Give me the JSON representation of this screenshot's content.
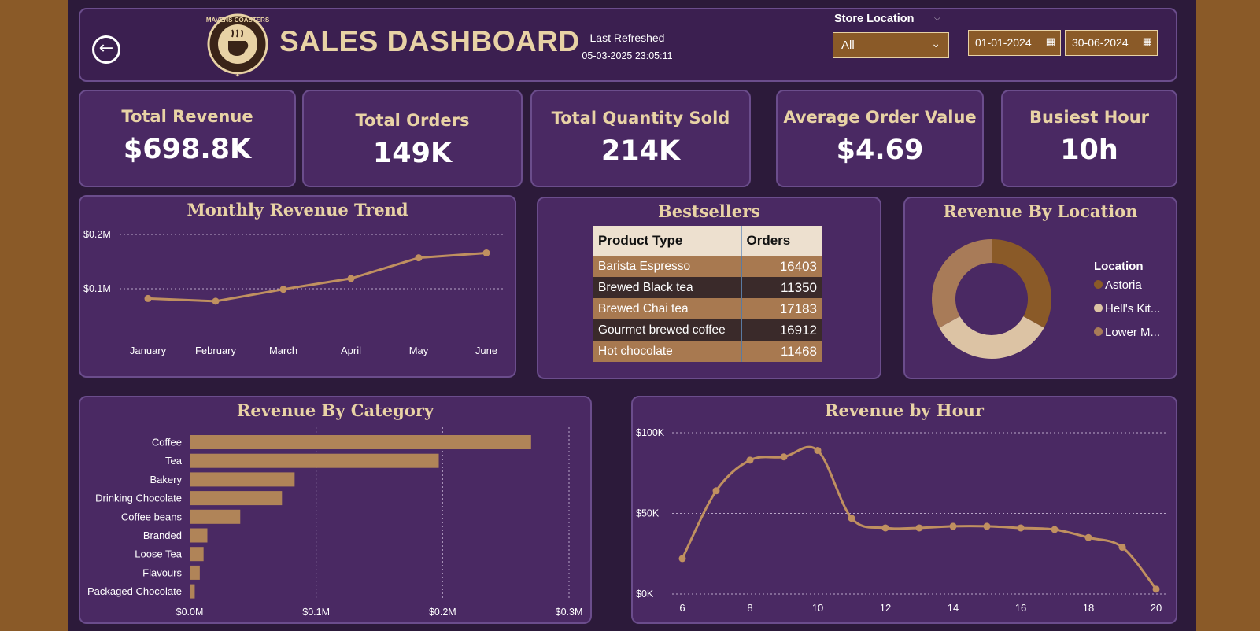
{
  "header": {
    "title": "SALES DASHBOARD",
    "logo_text": "MAVENS COASTERS",
    "refresh_label": "Last Refreshed",
    "refresh_date": "05-03-2025 23:05:11",
    "store_label": "Store Location",
    "store_value": "All",
    "date_from": "01-01-2024",
    "date_to": "30-06-2024"
  },
  "kpis": [
    {
      "label": "Total Revenue",
      "value": "$698.8K"
    },
    {
      "label": "Total Orders",
      "value": "149K"
    },
    {
      "label": "Total Quantity Sold",
      "value": "214K"
    },
    {
      "label": "Average Order Value",
      "value": "$4.69"
    },
    {
      "label": "Busiest Hour",
      "value": "10h"
    }
  ],
  "monthly": {
    "title": "Monthly Revenue Trend"
  },
  "bestsellers": {
    "title": "Bestsellers",
    "headers": [
      "Product Type",
      "Orders"
    ],
    "rows": [
      [
        "Barista Espresso",
        "16403"
      ],
      [
        "Brewed Black tea",
        "11350"
      ],
      [
        "Brewed Chai tea",
        "17183"
      ],
      [
        "Gourmet brewed coffee",
        "16912"
      ],
      [
        "Hot chocolate",
        "11468"
      ]
    ]
  },
  "location": {
    "title": "Revenue By Location",
    "legend_title": "Location",
    "items": [
      "Astoria",
      "Hell's Kit...",
      "Lower M..."
    ],
    "colors": [
      "#8a5a28",
      "#dcc3a4",
      "#a87b58"
    ]
  },
  "category": {
    "title": "Revenue By Category"
  },
  "hourly": {
    "title": "Revenue by Hour"
  },
  "chart_data": [
    {
      "type": "line",
      "title": "Monthly Revenue Trend",
      "categories": [
        "January",
        "February",
        "March",
        "April",
        "May",
        "June"
      ],
      "values": [
        0.082,
        0.077,
        0.099,
        0.119,
        0.157,
        0.166
      ],
      "ytick_labels": [
        "$0.1M",
        "$0.2M"
      ],
      "ylim": [
        0,
        0.2
      ],
      "color": "#c09060",
      "grid": true
    },
    {
      "type": "pie",
      "title": "Revenue By Location",
      "labels": [
        "Astoria",
        "Hell's Kit...",
        "Lower M..."
      ],
      "values": [
        0.33,
        0.34,
        0.33
      ],
      "colors": [
        "#8a5a28",
        "#dcc3a4",
        "#a87b58"
      ]
    },
    {
      "type": "bar",
      "title": "Revenue By Category",
      "categories": [
        "Coffee",
        "Tea",
        "Bakery",
        "Drinking Chocolate",
        "Coffee beans",
        "Branded",
        "Loose Tea",
        "Flavours",
        "Packaged Chocolate"
      ],
      "values": [
        0.27,
        0.197,
        0.083,
        0.073,
        0.04,
        0.014,
        0.011,
        0.008,
        0.004
      ],
      "xtick_labels": [
        "$0.0M",
        "$0.1M",
        "$0.2M",
        "$0.3M"
      ],
      "xlim": [
        0,
        0.3
      ],
      "color": "#b08458",
      "grid": true
    },
    {
      "type": "line",
      "title": "Revenue by Hour",
      "x": [
        6,
        7,
        8,
        9,
        10,
        11,
        12,
        13,
        14,
        15,
        16,
        17,
        18,
        19,
        20
      ],
      "values": [
        22,
        64,
        83,
        85,
        89,
        47,
        41,
        41,
        42,
        42,
        41,
        40,
        35,
        29,
        3
      ],
      "xtick_labels": [
        "6",
        "8",
        "10",
        "12",
        "14",
        "16",
        "18",
        "20"
      ],
      "ytick_labels": [
        "$0K",
        "$50K",
        "$100K"
      ],
      "ylim": [
        0,
        100
      ],
      "color": "#c09060",
      "grid": true
    }
  ]
}
